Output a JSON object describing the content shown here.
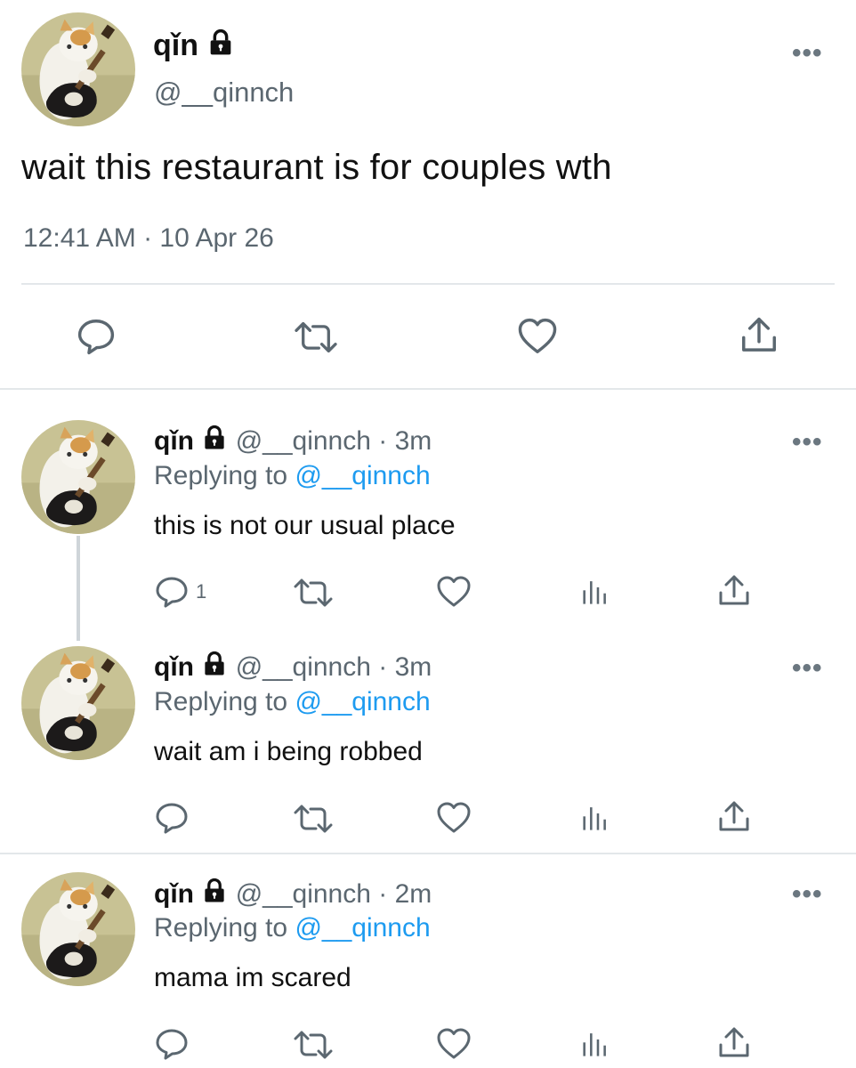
{
  "colors": {
    "text": "#111111",
    "secondary": "#5b6770",
    "mention": "#1d9bf0",
    "divider": "#e3e7ea",
    "thread_line": "#cfd5d9"
  },
  "main_tweet": {
    "display_name": "qǐn",
    "handle": "@__qinnch",
    "text": "wait this restaurant is for couples wth",
    "timestamp": "12:41 AM · 10 Apr 26",
    "more_label": "•••",
    "actions": [
      "comment-icon",
      "retweet-icon",
      "like-icon",
      "share-icon"
    ]
  },
  "replies": [
    {
      "display_name": "qǐn",
      "handle_time": "@__qinnch · 3m",
      "replying_label": "Replying to",
      "replying_to": "@__qinnch",
      "text": "this is not our usual place",
      "reply_count": "1",
      "more_label": "•••"
    },
    {
      "display_name": "qǐn",
      "handle_time": "@__qinnch · 3m",
      "replying_label": "Replying to",
      "replying_to": "@__qinnch",
      "text": "wait am i being robbed",
      "reply_count": "",
      "more_label": "•••"
    },
    {
      "display_name": "qǐn",
      "handle_time": "@__qinnch · 2m",
      "replying_label": "Replying to",
      "replying_to": "@__qinnch",
      "text": "mama im scared",
      "reply_count": "",
      "more_label": "•••"
    }
  ]
}
